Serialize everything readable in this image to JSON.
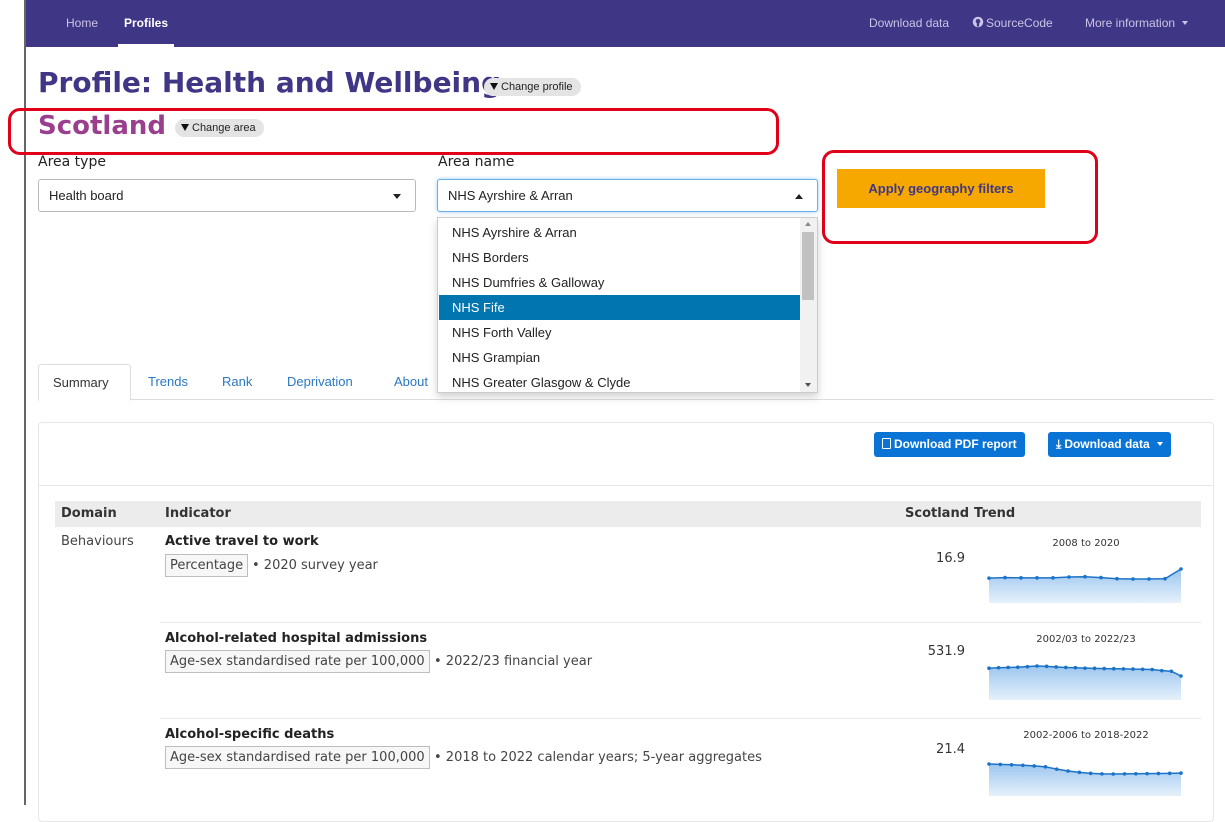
{
  "nav": {
    "home": "Home",
    "profiles": "Profiles",
    "download_data": "Download data",
    "source_code": "SourceCode",
    "more_info": "More information"
  },
  "header": {
    "profile_title": "Profile: Health and Wellbeing",
    "change_profile": "Change profile",
    "area_title": "Scotland",
    "change_area": "Change area"
  },
  "filters": {
    "area_type_label": "Area type",
    "area_type_value": "Health board",
    "area_name_label": "Area name",
    "area_name_value": "NHS Ayrshire & Arran",
    "apply_label": "Apply geography filters",
    "options": [
      "NHS Ayrshire & Arran",
      "NHS Borders",
      "NHS Dumfries & Galloway",
      "NHS Fife",
      "NHS Forth Valley",
      "NHS Grampian",
      "NHS Greater Glasgow & Clyde"
    ],
    "highlighted_option": "NHS Fife"
  },
  "tabs": [
    "Summary",
    "Trends",
    "Rank",
    "Deprivation",
    "About"
  ],
  "actions": {
    "download_pdf": "Download PDF report",
    "download_data": "Download data"
  },
  "table": {
    "headers": {
      "domain": "Domain",
      "indicator": "Indicator",
      "area": "Scotland",
      "trend": "Trend"
    },
    "domain": "Behaviours",
    "rows": [
      {
        "indicator": "Active travel to work",
        "measure": "Percentage",
        "period": "• 2020 survey year",
        "value": "16.9",
        "trend_range": "2008 to 2020",
        "trend": [
          13.7,
          13.9,
          13.8,
          13.8,
          13.8,
          14.1,
          14.2,
          13.9,
          13.5,
          13.4,
          13.4,
          13.5,
          16.9
        ]
      },
      {
        "indicator": "Alcohol-related hospital admissions",
        "measure": "Age-sex standardised rate per 100,000",
        "period": "• 2022/23 financial year",
        "value": "531.9",
        "trend_range": "2002/03 to 2022/23",
        "trend": [
          690,
          700,
          705,
          710,
          722,
          735,
          728,
          715,
          705,
          700,
          692,
          688,
          682,
          680,
          676,
          672,
          668,
          664,
          640,
          628,
          531.9
        ]
      },
      {
        "indicator": "Alcohol-specific deaths",
        "measure": "Age-sex standardised rate per 100,000",
        "period": "• 2018 to 2022 calendar years; 5-year aggregates",
        "value": "21.4",
        "trend_range": "2002-2006 to 2018-2022",
        "trend": [
          28.5,
          28.2,
          27.9,
          27.5,
          27.0,
          26.3,
          24.5,
          23.0,
          22.0,
          21.2,
          20.8,
          20.7,
          20.8,
          20.9,
          21.0,
          21.1,
          21.2,
          21.4
        ]
      }
    ]
  },
  "colors": {
    "navbar": "#3f3685",
    "title": "#3f3685",
    "area_title": "#9a3e8e",
    "apply_button": "#f6a800",
    "highlight": "#0075b0",
    "annotation": "#e0001a",
    "sparkline": "#1a73c9"
  }
}
